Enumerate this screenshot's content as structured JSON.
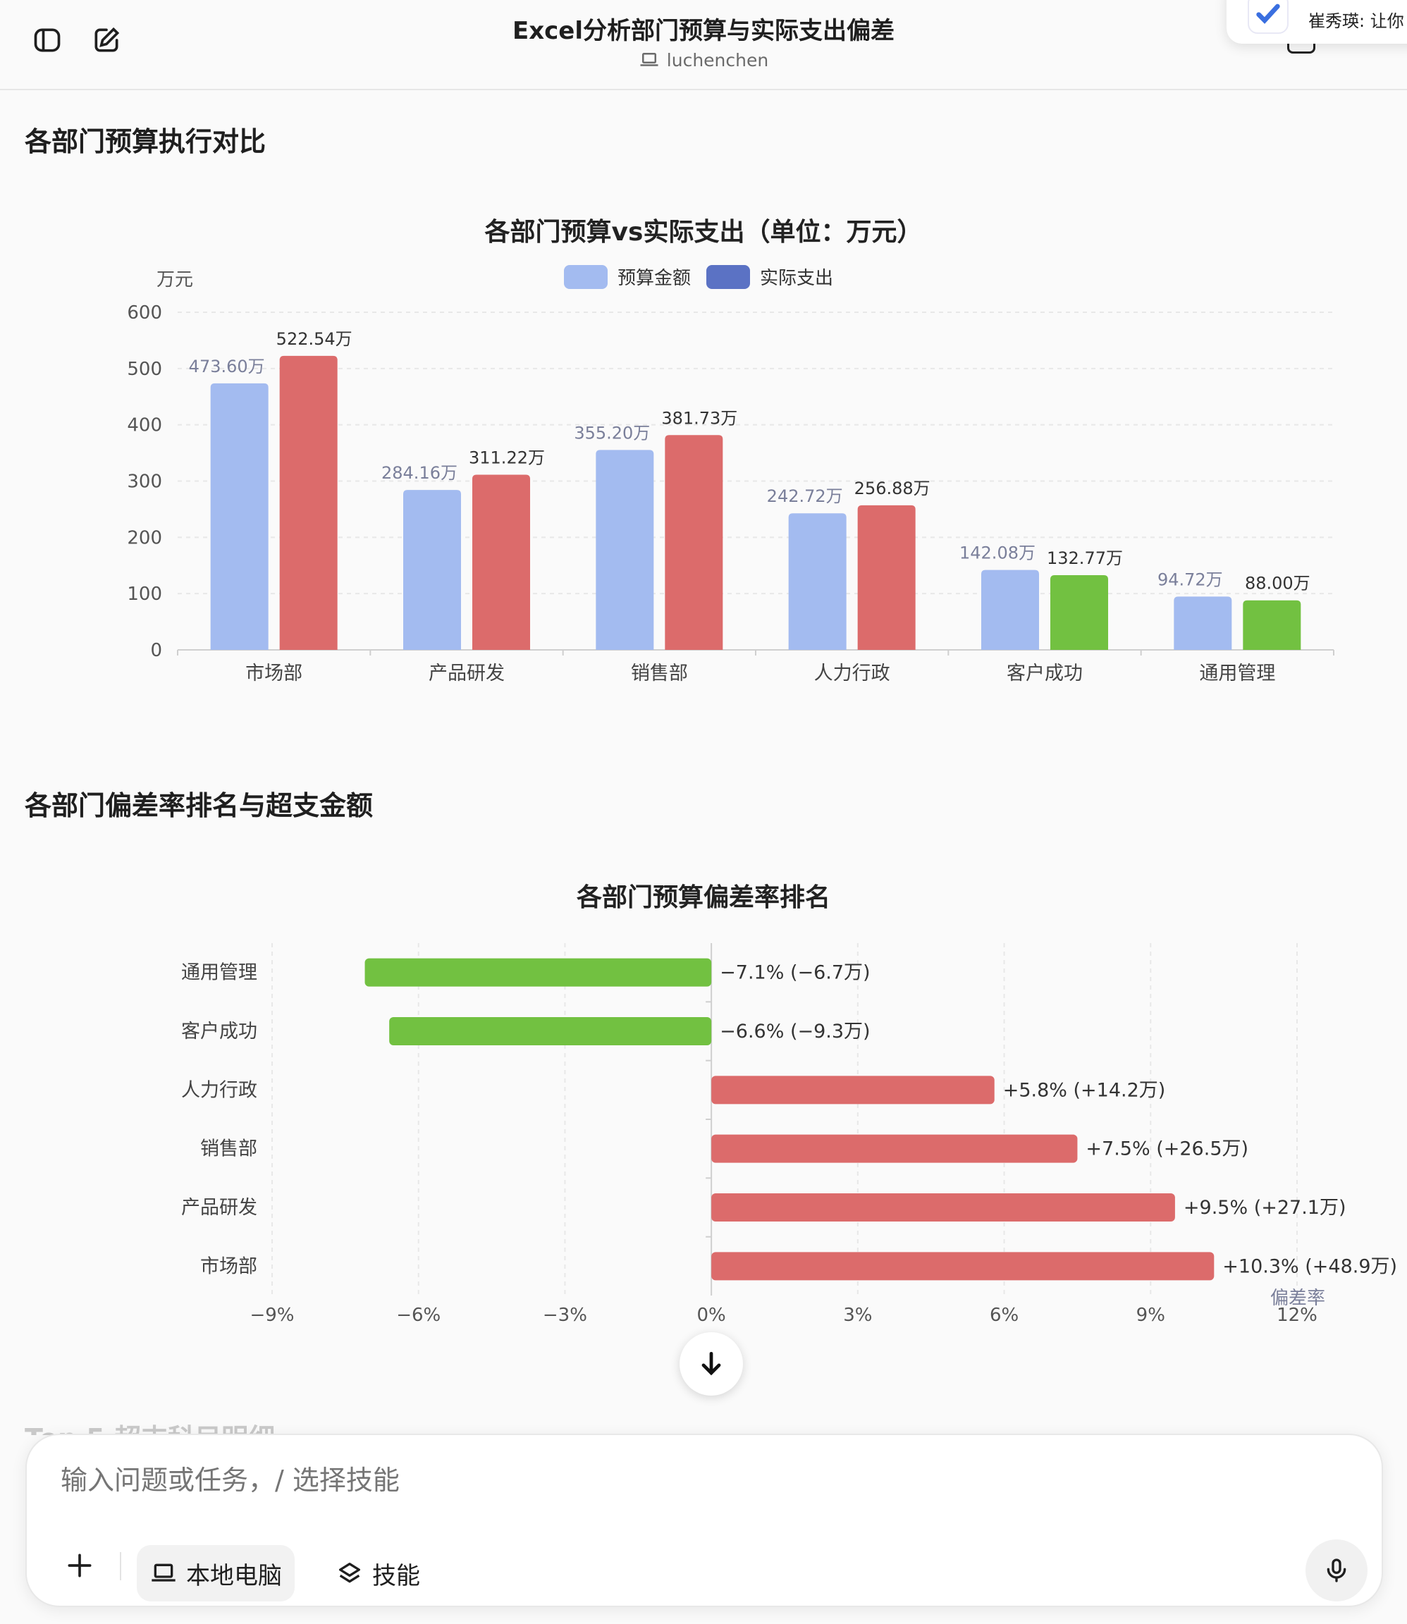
{
  "header": {
    "title": "Excel分析部门预算与实际支出偏差",
    "subtitle": "luchenchen",
    "notification": {
      "sender": "崔秀瑛: 让你"
    }
  },
  "section1": {
    "title": "各部门预算执行对比"
  },
  "section2": {
    "title": "各部门偏差率排名与超支金额"
  },
  "section3_peek": {
    "title": "Top 5 超支科目明细"
  },
  "colors": {
    "budget": "#a3bbf0",
    "actual_over": "#dc6b6b",
    "actual_under": "#72c141",
    "legend_actual": "#5b72c4"
  },
  "chart_data": [
    {
      "type": "bar",
      "title": "各部门预算vs实际支出（单位：万元）",
      "ylabel": "万元",
      "ylim": [
        0,
        600
      ],
      "yticks": [
        "0",
        "100",
        "200",
        "300",
        "400",
        "500",
        "600"
      ],
      "categories": [
        "市场部",
        "产品研发",
        "销售部",
        "人力行政",
        "客户成功",
        "通用管理"
      ],
      "series": [
        {
          "name": "预算金额",
          "values": [
            473.6,
            284.16,
            355.2,
            242.72,
            142.08,
            94.72
          ],
          "labels": [
            "473.60万",
            "284.16万",
            "355.20万",
            "242.72万",
            "142.08万",
            "94.72万"
          ]
        },
        {
          "name": "实际支出",
          "values": [
            522.54,
            311.22,
            381.73,
            256.88,
            132.77,
            88.0
          ],
          "labels": [
            "522.54万",
            "311.22万",
            "381.73万",
            "256.88万",
            "132.77万",
            "88.00万"
          ]
        }
      ],
      "legend": "top-center",
      "grid": true
    },
    {
      "type": "bar",
      "orientation": "horizontal",
      "title": "各部门预算偏差率排名",
      "xlim": [
        -9,
        12
      ],
      "xticks": [
        "−9%",
        "−6%",
        "−3%",
        "0%",
        "3%",
        "6%",
        "9%",
        "12%"
      ],
      "xlabel": "偏差率",
      "categories": [
        "通用管理",
        "客户成功",
        "人力行政",
        "销售部",
        "产品研发",
        "市场部"
      ],
      "values": [
        -7.1,
        -6.6,
        5.8,
        7.5,
        9.5,
        10.3
      ],
      "labels": [
        "−7.1% (−6.7万)",
        "−6.6% (−9.3万)",
        "+5.8% (+14.2万)",
        "+7.5% (+26.5万)",
        "+9.5% (+27.1万)",
        "+10.3% (+48.9万)"
      ]
    }
  ],
  "composer": {
    "placeholder": "输入问题或任务，/ 选择技能",
    "local_label": "本地电脑",
    "skill_label": "技能"
  }
}
